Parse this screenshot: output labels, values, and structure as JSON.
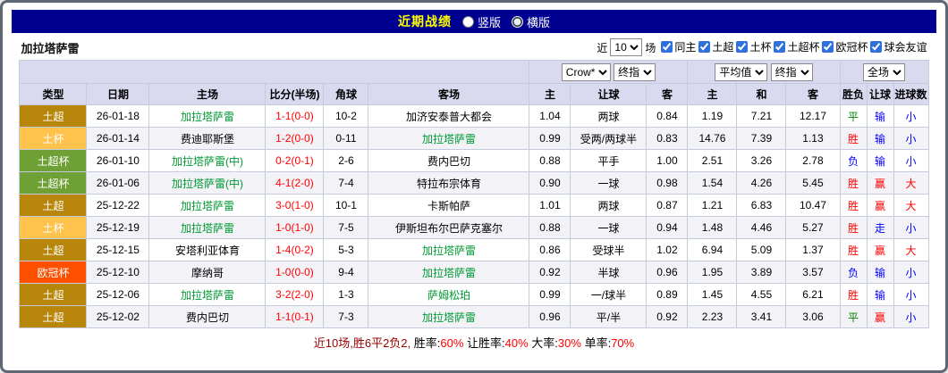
{
  "top_bar": {
    "title": "近期战绩",
    "layout_options": [
      {
        "label": "竖版",
        "selected": false
      },
      {
        "label": "横版",
        "selected": true
      }
    ]
  },
  "filter_bar": {
    "team": "加拉塔萨雷",
    "near_label": "近",
    "near_value": "10",
    "games_label": "场",
    "checkboxes": [
      {
        "label": "同主",
        "checked": true
      },
      {
        "label": "土超",
        "checked": true
      },
      {
        "label": "土杯",
        "checked": true
      },
      {
        "label": "土超杯",
        "checked": true
      },
      {
        "label": "欧冠杯",
        "checked": true
      },
      {
        "label": "球会友谊",
        "checked": true
      }
    ]
  },
  "selectors": {
    "odds_company": "Crow*",
    "odds_stage": "终指",
    "europe_avg": "平均值",
    "europe_stage": "终指",
    "scope": "全场"
  },
  "table": {
    "headers": [
      "类型",
      "日期",
      "主场",
      "比分(半场)",
      "角球",
      "客场",
      "主",
      "让球",
      "客",
      "主",
      "和",
      "客",
      "胜负",
      "让球",
      "进球数"
    ],
    "rows": [
      {
        "type": "土超",
        "type_bg": "#b8860b",
        "date": "26-01-18",
        "home": "加拉塔萨雷",
        "home_color": "#009933",
        "score": "1-1(0-0)",
        "corner": "10-2",
        "away": "加济安泰普大都会",
        "away_color": "#000000",
        "odds": [
          "1.04",
          "两球",
          "0.84"
        ],
        "avg": [
          "1.19",
          "7.21",
          "12.17"
        ],
        "result": {
          "text": "平",
          "color": "#008000"
        },
        "handicap": {
          "text": "输",
          "color": "#0000ff"
        },
        "goals": {
          "text": "小",
          "color": "#0000ff"
        }
      },
      {
        "type": "土杯",
        "type_bg": "#ffc34d",
        "date": "26-01-14",
        "home": "费迪耶斯堡",
        "home_color": "#000000",
        "score": "1-2(0-0)",
        "corner": "0-11",
        "away": "加拉塔萨雷",
        "away_color": "#009933",
        "odds": [
          "0.99",
          "受两/两球半",
          "0.83"
        ],
        "avg": [
          "14.76",
          "7.39",
          "1.13"
        ],
        "result": {
          "text": "胜",
          "color": "#ff0000"
        },
        "handicap": {
          "text": "输",
          "color": "#0000ff"
        },
        "goals": {
          "text": "小",
          "color": "#0000ff"
        }
      },
      {
        "type": "土超杯",
        "type_bg": "#6fa036",
        "date": "26-01-10",
        "home": "加拉塔萨雷(中)",
        "home_color": "#009933",
        "score": "0-2(0-1)",
        "corner": "2-6",
        "away": "费内巴切",
        "away_color": "#000000",
        "odds": [
          "0.88",
          "平手",
          "1.00"
        ],
        "avg": [
          "2.51",
          "3.26",
          "2.78"
        ],
        "result": {
          "text": "负",
          "color": "#0000ff"
        },
        "handicap": {
          "text": "输",
          "color": "#0000ff"
        },
        "goals": {
          "text": "小",
          "color": "#0000ff"
        }
      },
      {
        "type": "土超杯",
        "type_bg": "#6fa036",
        "date": "26-01-06",
        "home": "加拉塔萨雷(中)",
        "home_color": "#009933",
        "score": "4-1(2-0)",
        "corner": "7-4",
        "away": "特拉布宗体育",
        "away_color": "#000000",
        "odds": [
          "0.90",
          "一球",
          "0.98"
        ],
        "avg": [
          "1.54",
          "4.26",
          "5.45"
        ],
        "result": {
          "text": "胜",
          "color": "#ff0000"
        },
        "handicap": {
          "text": "赢",
          "color": "#ff0000"
        },
        "goals": {
          "text": "大",
          "color": "#ff0000"
        }
      },
      {
        "type": "土超",
        "type_bg": "#b8860b",
        "date": "25-12-22",
        "home": "加拉塔萨雷",
        "home_color": "#009933",
        "score": "3-0(1-0)",
        "corner": "10-1",
        "away": "卡斯帕萨",
        "away_color": "#000000",
        "odds": [
          "1.01",
          "两球",
          "0.87"
        ],
        "avg": [
          "1.21",
          "6.83",
          "10.47"
        ],
        "result": {
          "text": "胜",
          "color": "#ff0000"
        },
        "handicap": {
          "text": "赢",
          "color": "#ff0000"
        },
        "goals": {
          "text": "大",
          "color": "#ff0000"
        }
      },
      {
        "type": "土杯",
        "type_bg": "#ffc34d",
        "date": "25-12-19",
        "home": "加拉塔萨雷",
        "home_color": "#009933",
        "score": "1-0(1-0)",
        "corner": "7-5",
        "away": "伊斯坦布尔巴萨克塞尔",
        "away_color": "#000000",
        "odds": [
          "0.88",
          "一球",
          "0.94"
        ],
        "avg": [
          "1.48",
          "4.46",
          "5.27"
        ],
        "result": {
          "text": "胜",
          "color": "#ff0000"
        },
        "handicap": {
          "text": "走",
          "color": "#0000ff"
        },
        "goals": {
          "text": "小",
          "color": "#0000ff"
        }
      },
      {
        "type": "土超",
        "type_bg": "#b8860b",
        "date": "25-12-15",
        "home": "安塔利亚体育",
        "home_color": "#000000",
        "score": "1-4(0-2)",
        "corner": "5-3",
        "away": "加拉塔萨雷",
        "away_color": "#009933",
        "odds": [
          "0.86",
          "受球半",
          "1.02"
        ],
        "avg": [
          "6.94",
          "5.09",
          "1.37"
        ],
        "result": {
          "text": "胜",
          "color": "#ff0000"
        },
        "handicap": {
          "text": "赢",
          "color": "#ff0000"
        },
        "goals": {
          "text": "大",
          "color": "#ff0000"
        }
      },
      {
        "type": "欧冠杯",
        "type_bg": "#ff5000",
        "date": "25-12-10",
        "home": "摩纳哥",
        "home_color": "#000000",
        "score": "1-0(0-0)",
        "corner": "9-4",
        "away": "加拉塔萨雷",
        "away_color": "#009933",
        "odds": [
          "0.92",
          "半球",
          "0.96"
        ],
        "avg": [
          "1.95",
          "3.89",
          "3.57"
        ],
        "result": {
          "text": "负",
          "color": "#0000ff"
        },
        "handicap": {
          "text": "输",
          "color": "#0000ff"
        },
        "goals": {
          "text": "小",
          "color": "#0000ff"
        }
      },
      {
        "type": "土超",
        "type_bg": "#b8860b",
        "date": "25-12-06",
        "home": "加拉塔萨雷",
        "home_color": "#009933",
        "score": "3-2(2-0)",
        "corner": "1-3",
        "away": "萨姆松珀",
        "away_color": "#009933",
        "odds": [
          "0.99",
          "一/球半",
          "0.89"
        ],
        "avg": [
          "1.45",
          "4.55",
          "6.21"
        ],
        "result": {
          "text": "胜",
          "color": "#ff0000"
        },
        "handicap": {
          "text": "输",
          "color": "#0000ff"
        },
        "goals": {
          "text": "小",
          "color": "#0000ff"
        }
      },
      {
        "type": "土超",
        "type_bg": "#b8860b",
        "date": "25-12-02",
        "home": "费内巴切",
        "home_color": "#000000",
        "score": "1-1(0-1)",
        "corner": "7-3",
        "away": "加拉塔萨雷",
        "away_color": "#009933",
        "odds": [
          "0.96",
          "平/半",
          "0.92"
        ],
        "avg": [
          "2.23",
          "3.41",
          "3.06"
        ],
        "result": {
          "text": "平",
          "color": "#008000"
        },
        "handicap": {
          "text": "赢",
          "color": "#ff0000"
        },
        "goals": {
          "text": "小",
          "color": "#0000ff"
        }
      }
    ]
  },
  "footer": {
    "segments": [
      {
        "text": "近10场,胜6平2负2, ",
        "color": "#990000"
      },
      {
        "text": "胜率:",
        "color": "#000000"
      },
      {
        "text": "60%",
        "color": "#ff0000"
      },
      {
        "text": " 让胜率:",
        "color": "#000000"
      },
      {
        "text": "40%",
        "color": "#ff0000"
      },
      {
        "text": " 大率:",
        "color": "#000000"
      },
      {
        "text": "30%",
        "color": "#ff0000"
      },
      {
        "text": " 单率:",
        "color": "#000000"
      },
      {
        "text": "70%",
        "color": "#ff0000"
      }
    ]
  },
  "colors": {
    "topbar_bg": "#000090",
    "title_text": "#ffff00",
    "header_bg": "#d9d9f0",
    "grid_line": "#c3cbdd",
    "team_highlight": "#009933",
    "score_red": "#ff0000",
    "win_red": "#ff0000",
    "lose_blue": "#0000ff",
    "draw_green": "#008000"
  }
}
